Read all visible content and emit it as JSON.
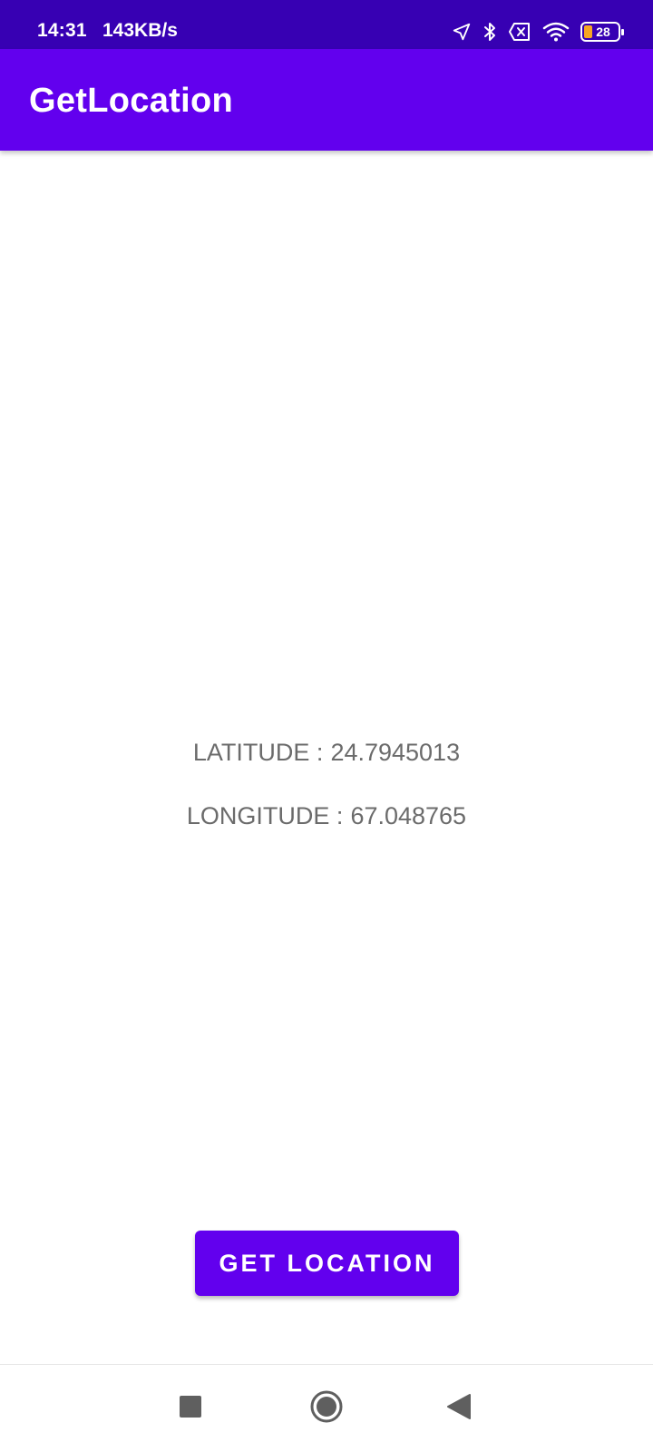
{
  "status_bar": {
    "time": "14:31",
    "network_speed": "143KB/s",
    "battery_level": "28",
    "icons": [
      "location-icon",
      "bluetooth-icon",
      "sim-none-icon",
      "wifi-icon",
      "battery-icon"
    ]
  },
  "app_bar": {
    "title": "GetLocation"
  },
  "location": {
    "latitude_label": "LATITUDE :",
    "latitude_value": "24.7945013",
    "longitude_label": "LONGITUDE :",
    "longitude_value": "67.048765"
  },
  "actions": {
    "get_location_label": "GET LOCATION"
  },
  "navigation": {
    "icons": [
      "recents-icon",
      "home-icon",
      "back-icon"
    ]
  },
  "colors": {
    "status_bar": "#3700B3",
    "primary": "#6200EE",
    "text_secondary": "#6b6b6b",
    "nav_icon": "#5f5f5f"
  }
}
